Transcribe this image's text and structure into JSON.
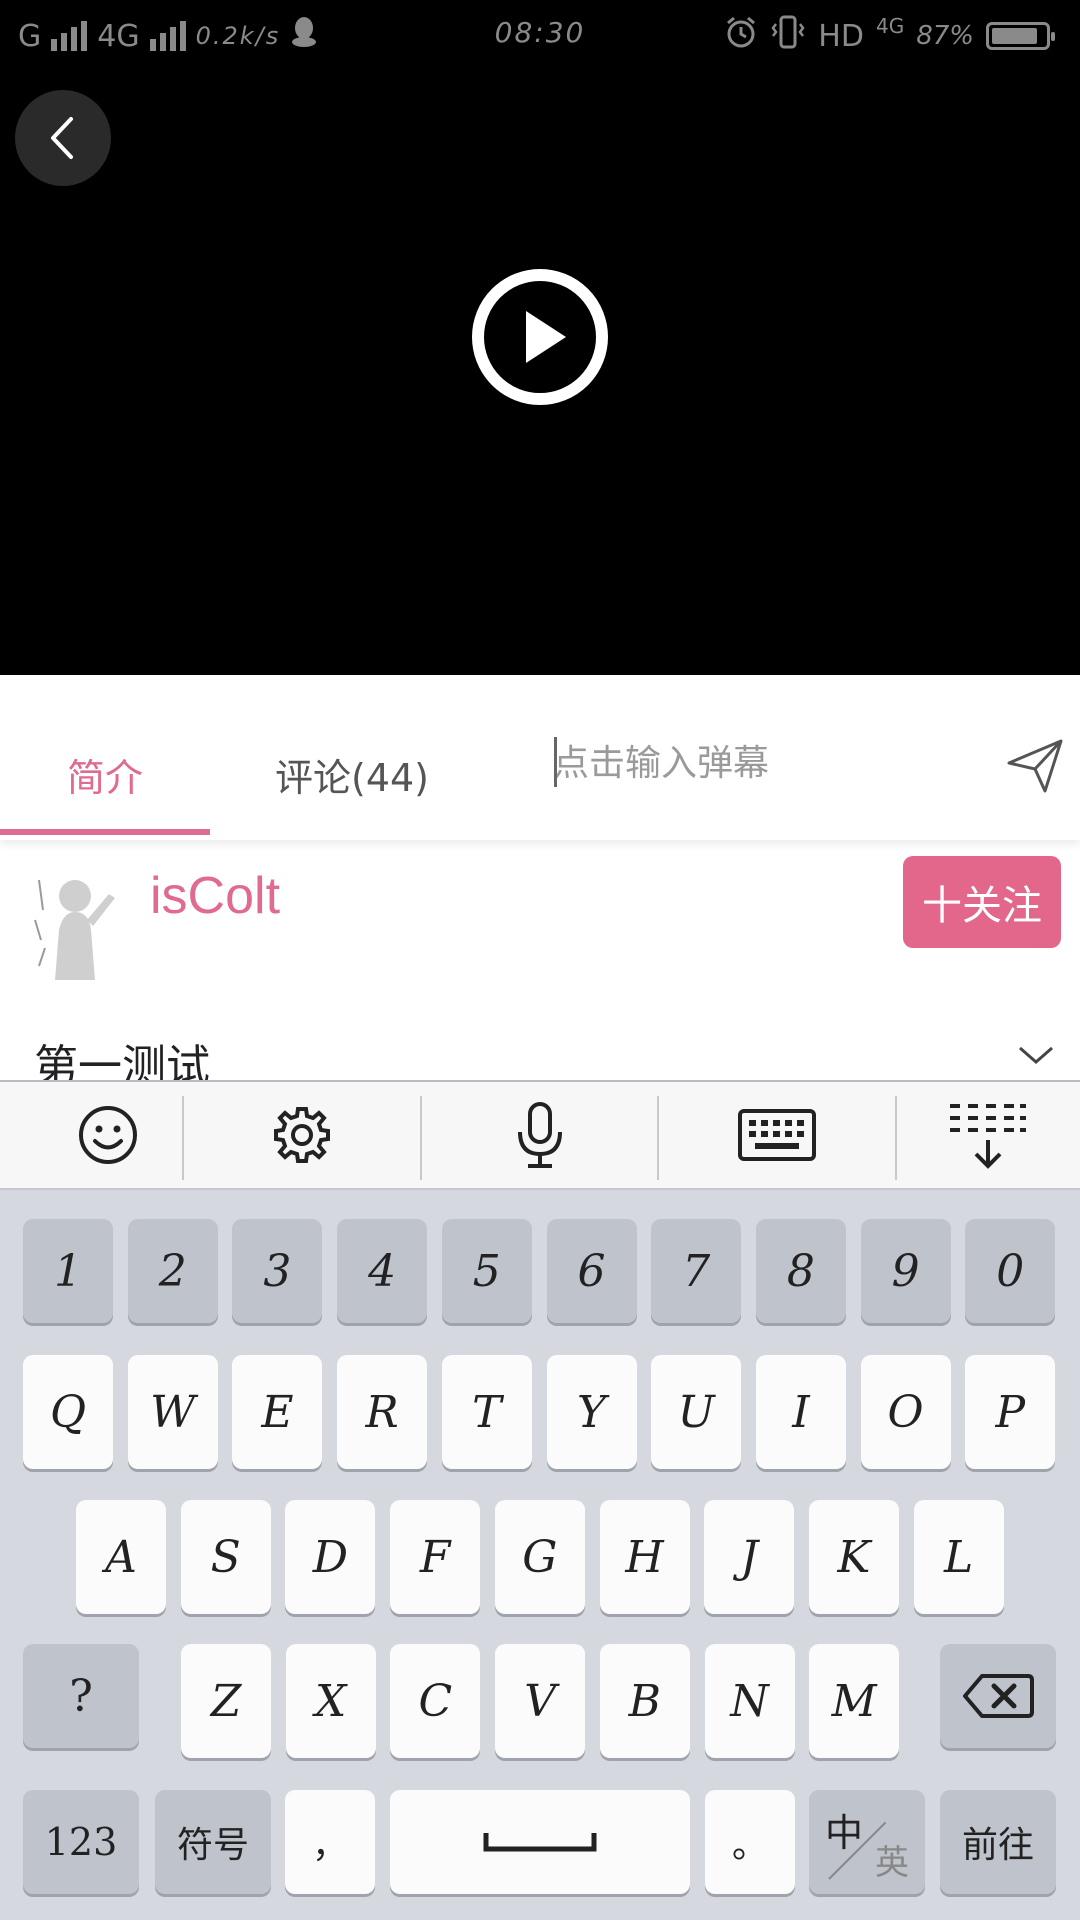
{
  "status_bar": {
    "network_left": "G",
    "network_mid": "4G",
    "speed": "0.2k/s",
    "time": "08:30",
    "hd": "HD",
    "network_right": "4G",
    "battery_percent": "87%",
    "battery_level": 0.87,
    "icons": [
      "signal-icon",
      "qq-icon",
      "alarm-icon",
      "vibrate-icon",
      "battery-icon"
    ]
  },
  "video": {
    "back_icon": "chevron-left-icon",
    "play_icon": "play-icon"
  },
  "tabs": {
    "items": [
      {
        "label": "简介",
        "active": true
      },
      {
        "label": "评论(44)",
        "active": false
      }
    ],
    "danmaku_placeholder": "点击输入弹幕",
    "send_icon": "send-icon"
  },
  "author": {
    "name": "isColt",
    "follow_label": "十关注"
  },
  "content": {
    "video_title": "第一测试",
    "expand_icon": "chevron-down-icon"
  },
  "keyboard": {
    "toolbar_icons": [
      "emoji-icon",
      "gear-icon",
      "microphone-icon",
      "keyboard-icon",
      "collapse-keyboard-icon"
    ],
    "number_row": [
      "1",
      "2",
      "3",
      "4",
      "5",
      "6",
      "7",
      "8",
      "9",
      "0"
    ],
    "row1": [
      "Q",
      "W",
      "E",
      "R",
      "T",
      "Y",
      "U",
      "I",
      "O",
      "P"
    ],
    "row2": [
      "A",
      "S",
      "D",
      "F",
      "G",
      "H",
      "J",
      "K",
      "L"
    ],
    "row3": [
      "Z",
      "X",
      "C",
      "V",
      "B",
      "N",
      "M"
    ],
    "question": "?",
    "numbers_key": "123",
    "symbols_key": "符号",
    "comma": "，",
    "period": "。",
    "lang_zh": "中",
    "lang_en": "英",
    "go_key": "前往"
  },
  "colors": {
    "accent": "#e06b8f",
    "video_bg": "#000000",
    "keyboard_bg": "#d5d8df"
  }
}
